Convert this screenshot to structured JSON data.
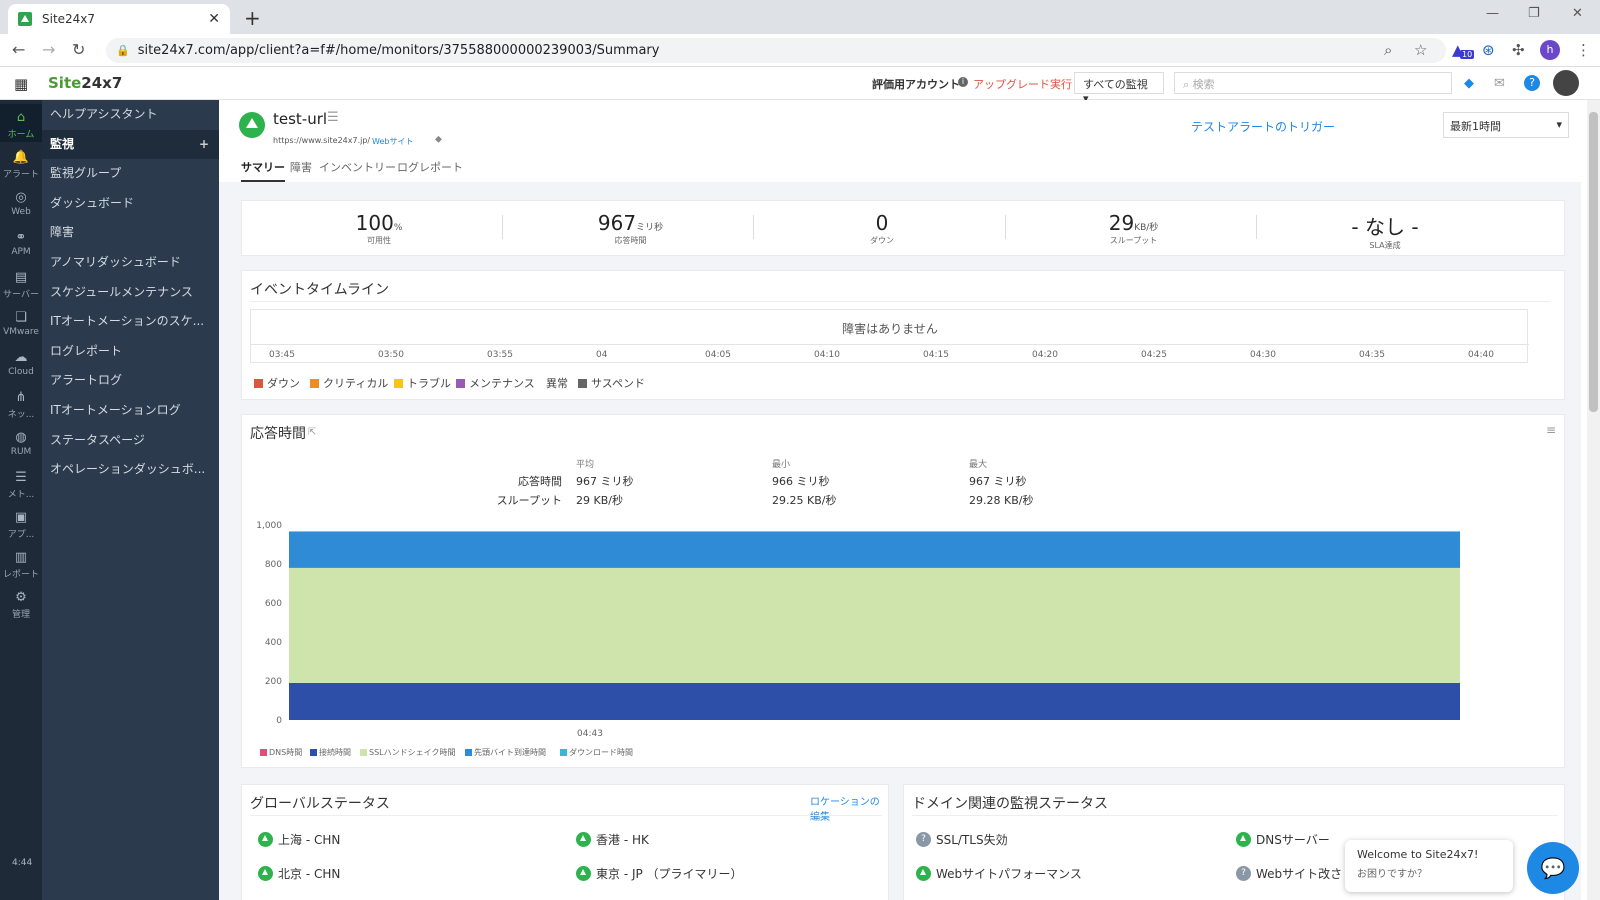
{
  "browser": {
    "tab_title": "Site24x7",
    "url": "site24x7.com/app/client?a=f#/home/monitors/375588000000239003/Summary",
    "profile_initial": "h",
    "ext_badge": "10"
  },
  "header": {
    "logo_prefix": "Site",
    "logo_suffix": "24x7",
    "trial_label": "評価用アカウント",
    "upgrade_label": "アップグレード実行",
    "all_monitors": "すべての監視",
    "search_placeholder": "検索"
  },
  "rail": {
    "items": [
      {
        "label": "ホーム",
        "icon": "home-icon"
      },
      {
        "label": "アラート",
        "icon": "bell-icon"
      },
      {
        "label": "Web",
        "icon": "globe-icon"
      },
      {
        "label": "APM",
        "icon": "binoculars-icon"
      },
      {
        "label": "サーバー",
        "icon": "server-icon"
      },
      {
        "label": "VMware",
        "icon": "vmware-icon"
      },
      {
        "label": "Cloud",
        "icon": "cloud-icon"
      },
      {
        "label": "ネッ...",
        "icon": "network-icon"
      },
      {
        "label": "RUM",
        "icon": "rum-icon"
      },
      {
        "label": "メト...",
        "icon": "metrics-icon"
      },
      {
        "label": "アプ...",
        "icon": "apps-icon"
      },
      {
        "label": "レポート",
        "icon": "report-icon"
      },
      {
        "label": "管理",
        "icon": "gear-icon"
      }
    ],
    "time": "4:44"
  },
  "subnav": {
    "items": [
      "ヘルプアシスタント",
      "監視",
      "監視グループ",
      "ダッシュボード",
      "障害",
      "アノマリダッシュボード",
      "スケジュールメンテナンス",
      "ITオートメーションのスケ...",
      "ログレポート",
      "アラートログ",
      "ITオートメーションログ",
      "ステータスページ",
      "オペレーションダッシュボ..."
    ],
    "plus": "+"
  },
  "monitor": {
    "name": "test-url",
    "url": "https://www.site24x7.jp/",
    "type": "Webサイト",
    "test_alert": "テストアラートのトリガー",
    "period": "最新1時間",
    "tabs": [
      "サマリー",
      "障害",
      "インベントリー",
      "ログレポート"
    ]
  },
  "stats": [
    {
      "value": "100",
      "unit": "%",
      "label": "可用性"
    },
    {
      "value": "967",
      "unit": "ミリ秒",
      "label": "応答時間"
    },
    {
      "value": "0",
      "unit": "",
      "label": "ダウン"
    },
    {
      "value": "29",
      "unit": "KB/秒",
      "label": "スループット"
    },
    {
      "value": "- なし -",
      "unit": "",
      "label": "SLA達成"
    }
  ],
  "timeline": {
    "title": "イベントタイムライン",
    "message": "障害はありません",
    "ticks": [
      "03:45",
      "03:50",
      "03:55",
      "04",
      "04:05",
      "04:10",
      "04:15",
      "04:20",
      "04:25",
      "04:30",
      "04:35",
      "04:40"
    ],
    "legend": [
      {
        "label": "ダウン",
        "color": "#e0533f"
      },
      {
        "label": "クリティカル",
        "color": "#f08a24"
      },
      {
        "label": "トラブル",
        "color": "#f5c518"
      },
      {
        "label": "メンテナンス",
        "color": "#9b59b6"
      },
      {
        "label": "異常",
        "color": ""
      },
      {
        "label": "サスペンド",
        "color": "#666666"
      }
    ]
  },
  "response": {
    "title": "応答時間",
    "headers": [
      "平均",
      "最小",
      "最大"
    ],
    "rows": [
      {
        "label": "応答時間",
        "avg": "967 ミリ秒",
        "min": "966 ミリ秒",
        "max": "967 ミリ秒"
      },
      {
        "label": "スループット",
        "avg": "29 KB/秒",
        "min": "29.25 KB/秒",
        "max": "29.28 KB/秒"
      }
    ]
  },
  "chart_data": {
    "type": "area",
    "x": [
      "04:43"
    ],
    "ylim": [
      0,
      1000
    ],
    "yticks": [
      "0",
      "200",
      "400",
      "600",
      "800",
      "1,000"
    ],
    "series": [
      {
        "name": "DNS時間",
        "values": [
          0
        ],
        "color": "#e84a7a"
      },
      {
        "name": "接続時間",
        "values": [
          190
        ],
        "color": "#2e4fa8"
      },
      {
        "name": "SSLハンドシェイク時間",
        "values": [
          590
        ],
        "color": "#cfe3ac"
      },
      {
        "name": "先頭バイト到達時間",
        "values": [
          187
        ],
        "color": "#2f8bd6"
      },
      {
        "name": "ダウンロード時間",
        "values": [
          0
        ],
        "color": "#35b8d8"
      }
    ]
  },
  "global_status": {
    "title": "グローバルステータス",
    "edit_link": "ロケーションの編集",
    "locations": [
      "上海 - CHN",
      "香港 - HK",
      "北京 - CHN",
      "東京 - JP （プライマリー）"
    ]
  },
  "domain_status": {
    "title": "ドメイン関連の監視ステータス",
    "items": [
      {
        "label": "SSL/TLS失効",
        "status": "unknown"
      },
      {
        "label": "DNSサーバー",
        "status": "up"
      },
      {
        "label": "Webサイトパフォーマンス",
        "status": "up"
      },
      {
        "label": "Webサイト改さ",
        "status": "unknown"
      }
    ]
  },
  "chat": {
    "line1": "Welcome to Site24x7!",
    "line2": "お困りですか？"
  }
}
